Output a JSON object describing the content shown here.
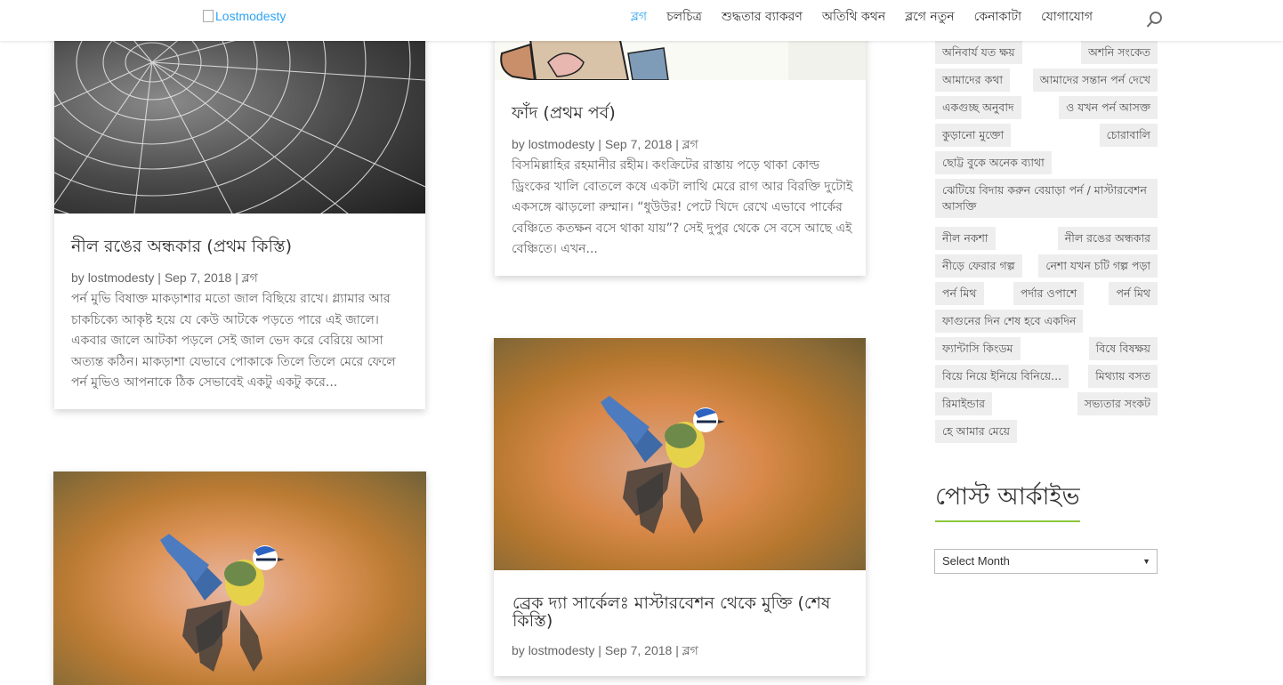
{
  "header": {
    "logo_alt": "Lostmodesty",
    "nav": [
      "ব্লগ",
      "চলচিত্র",
      "শুদ্ধতার ব্যাকরণ",
      "অতিথি কথন",
      "ব্লগে নতুন",
      "কেনাকাটা",
      "যোগাযোগ"
    ]
  },
  "posts": [
    {
      "title": "নীল রঙের অন্ধকার (প্রথম কিস্তি)",
      "author": "lostmodesty",
      "date": "Sep 7, 2018",
      "category": "ব্লগ",
      "excerpt": "পর্ন মুভি বিষাক্ত মাকড়াশার মতো জাল বিছিয়ে রাখে। গ্ল্যামার আর চাকচিক্যে আকৃষ্ট হয়ে যে কেউ আটকে পড়তে পারে এই জালে। একবার জালে আটকা পড়লে সেই জাল ভেদ করে বেরিয়ে আসা অত্যন্ত কঠিন। মাকড়াশা যেভাবে পোকাকে তিলে তিলে মেরে ফেলে পর্ন মুভিও আপনাকে ঠিক সেভাবেই একটু একটু করে..."
    },
    {
      "title": "ফাঁদ (প্রথম পর্ব)",
      "author": "lostmodesty",
      "date": "Sep 7, 2018",
      "category": "ব্লগ",
      "excerpt": "বিসমিল্লাহির রহমানীর রহীম। কংক্রিটের রাস্তায় পড়ে থাকা কোল্ড ড্রিংকের খালি বোতলে কষে একটা লাথি মেরে রাগ আর বিরক্তি দুটোই একসঙ্গে ঝাড়লো রুম্মান। “ধুউউর! পেটে খিদে রেখে এভাবে পার্কের বেঞ্চিতে কতক্ষন বসে থাকা যায়”? সেই দুপুর থেকে সে বসে আছে এই বেঞ্চিতে। এখন..."
    },
    {
      "title": "ব্রেক দ্যা সার্কেলঃ মাস্টারবেশন থেকে মুক্তি (শেষ কিস্তি)",
      "author": "lostmodesty",
      "date": "Sep 7, 2018",
      "category": "ব্লগ"
    }
  ],
  "meta_by": "by",
  "meta_sep": "|",
  "sidebar": {
    "tags": [
      "অনিবার্য যত ক্ষয়",
      "অশনি সংকেত",
      "আমাদের কথা",
      "আমাদের সন্তান পর্ন দেখে",
      "একগুচ্ছ অনুবাদ",
      "ও যখন পর্ন আসক্ত",
      "কুড়ানো মুক্তো",
      "চোরাবালি",
      "ছোট্ট বুকে অনেক ব্যাথা",
      "ঝেটিয়ে বিদায় করুন বেয়াড়া পর্ন / মাস্টারবেশন আসক্তি",
      "নীল নকশা",
      "নীল রঙের অন্ধকার",
      "নীড়ে ফেরার গল্প",
      "নেশা যখন চটি গল্প পড়া",
      "পর্ন মিথ",
      "পর্দার ওপাশে",
      "পর্ন মিথ",
      "ফাগুনের দিন শেষ হবে একদিন",
      "ফ্যান্টাসি কিংডম",
      "বিষে বিষক্ষয়",
      "বিয়ে নিয়ে ইনিয়ে বিনিয়ে...",
      "মিথ্যায় বসত",
      "রিমাইন্ডার",
      "সভ্যতার সংকট",
      "হে আমার মেয়ে"
    ],
    "archive_title": "পোস্ট আর্কাইভ",
    "archive_select": "Select Month"
  },
  "colors": {
    "accent": "#2ea3f2",
    "underline": "#8cc63f"
  },
  "icons": {
    "search": "search-icon",
    "select_arrow": "▼"
  }
}
